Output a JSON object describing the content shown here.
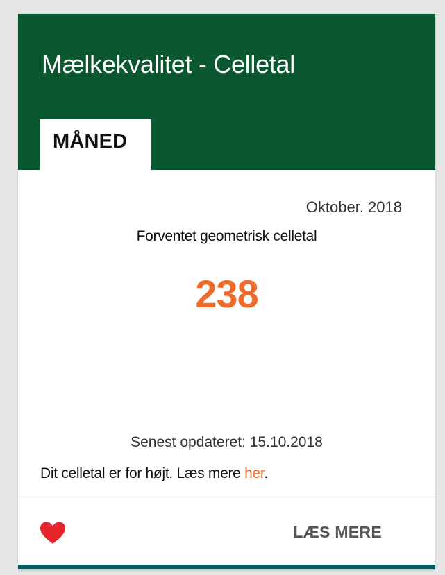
{
  "card": {
    "title": "Mælkekvalitet - Celletal",
    "tab_label": "MÅNED",
    "period": "Oktober. 2018",
    "metric_label": "Forventet geometrisk celletal",
    "metric_value": "238",
    "updated": "Senest opdateret: 15.10.2018",
    "notice_text": "Dit celletal er for højt. Læs mere ",
    "notice_link": "her",
    "notice_suffix": ".",
    "read_more": "LÆS MERE",
    "favorite_icon": "heart-icon"
  },
  "colors": {
    "header": "#0b5730",
    "accent": "#ef6b2c",
    "heart": "#e5262d",
    "bottom_bar": "#0d5960"
  }
}
